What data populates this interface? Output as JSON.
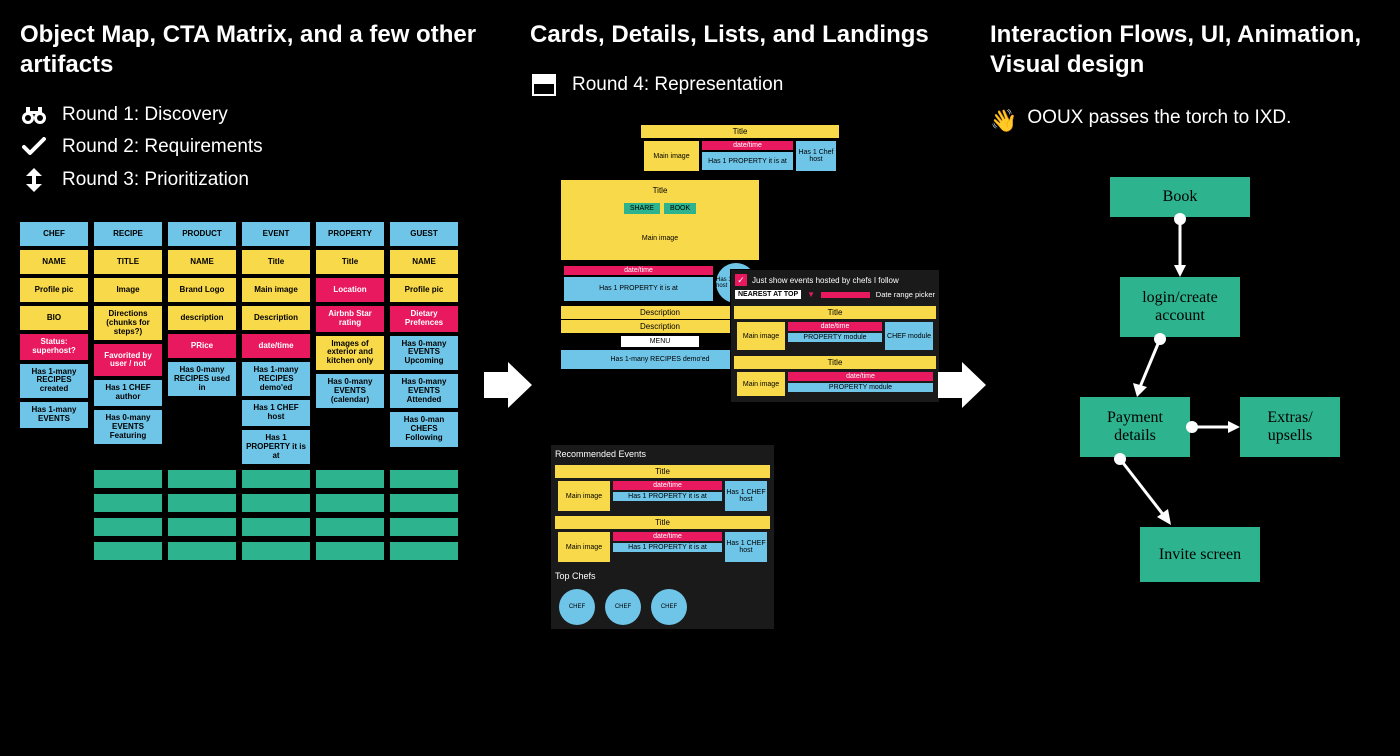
{
  "col1": {
    "heading": "Object Map, CTA Matrix, and a few other artifacts",
    "rounds": [
      {
        "icon": "binoculars",
        "label": "Round 1: Discovery"
      },
      {
        "icon": "check",
        "label": "Round 2: Requirements"
      },
      {
        "icon": "updown",
        "label": "Round 3: Prioritization"
      }
    ],
    "objmap": {
      "columns": [
        {
          "header": "CHEF",
          "cells": [
            {
              "t": "NAME",
              "c": "y"
            },
            {
              "t": "Profile pic",
              "c": "y"
            },
            {
              "t": "BIO",
              "c": "y"
            },
            {
              "t": "Status: superhost?",
              "c": "p"
            },
            {
              "t": "Has 1-many RECIPES created",
              "c": "b"
            },
            {
              "t": "Has 1-many EVENTS",
              "c": "b"
            }
          ]
        },
        {
          "header": "RECIPE",
          "cells": [
            {
              "t": "TITLE",
              "c": "y"
            },
            {
              "t": "Image",
              "c": "y"
            },
            {
              "t": "Directions (chunks for steps?)",
              "c": "y"
            },
            {
              "t": "Favorited by user / not",
              "c": "p"
            },
            {
              "t": "Has 1 CHEF author",
              "c": "b"
            },
            {
              "t": "Has 0-many EVENTS Featuring",
              "c": "b"
            }
          ]
        },
        {
          "header": "PRODUCT",
          "cells": [
            {
              "t": "NAME",
              "c": "y"
            },
            {
              "t": "Brand Logo",
              "c": "y"
            },
            {
              "t": "description",
              "c": "y"
            },
            {
              "t": "PRice",
              "c": "p"
            },
            {
              "t": "Has 0-many RECIPES used in",
              "c": "b"
            }
          ]
        },
        {
          "header": "EVENT",
          "cells": [
            {
              "t": "Title",
              "c": "y"
            },
            {
              "t": "Main image",
              "c": "y"
            },
            {
              "t": "Description",
              "c": "y"
            },
            {
              "t": "date/time",
              "c": "p"
            },
            {
              "t": "Has 1-many RECIPES demo'ed",
              "c": "b"
            },
            {
              "t": "Has 1 CHEF host",
              "c": "b"
            },
            {
              "t": "Has 1 PROPERTY it is at",
              "c": "b"
            }
          ]
        },
        {
          "header": "PROPERTY",
          "cells": [
            {
              "t": "Title",
              "c": "y"
            },
            {
              "t": "Location",
              "c": "p"
            },
            {
              "t": "Airbnb Star rating",
              "c": "p"
            },
            {
              "t": "Images of exterior and kitchen only",
              "c": "y"
            },
            {
              "t": "Has 0-many EVENTS (calendar)",
              "c": "b"
            }
          ]
        },
        {
          "header": "GUEST",
          "cells": [
            {
              "t": "NAME",
              "c": "y"
            },
            {
              "t": "Profile pic",
              "c": "y"
            },
            {
              "t": "Dietary Prefences",
              "c": "p"
            },
            {
              "t": "Has 0-many EVENTS Upcoming",
              "c": "b"
            },
            {
              "t": "Has 0-many EVENTS Attended",
              "c": "b"
            },
            {
              "t": "Has 0-man CHEFS Following",
              "c": "b"
            }
          ]
        }
      ],
      "greenbars_cols": 5,
      "greenbars_rows": 4
    }
  },
  "col2": {
    "heading": "Cards, Details, Lists, and Landings",
    "round": {
      "icon": "card",
      "label": "Round 4: Representation"
    },
    "wf": {
      "title": "Title",
      "main_image": "Main image",
      "date_time": "date/time",
      "has_property": "Has 1 PROPERTY it is at",
      "chef_host": "Has 1 Chef host",
      "chef_host2": "Has 1 CHEF host",
      "share": "SHARE",
      "book": "BOOK",
      "description": "Description",
      "menu": "MENU",
      "recipes": "Has 1-many RECIPES demo'ed",
      "filter_label": "Just show events hosted by chefs I follow",
      "sort_label": "NEAREST AT TOP",
      "date_range": "Date range picker",
      "prop_module": "PROPERTY module",
      "chef_module": "CHEF module",
      "rec_events": "Recommended Events",
      "top_chefs": "Top Chefs",
      "chef": "CHEF"
    }
  },
  "col3": {
    "heading": "Interaction Flows, UI, Animation, Visual design",
    "handoff_icon": "👋",
    "handoff_text": "OOUX  passes the torch to IXD.",
    "flow": {
      "nodes": {
        "book": "Book",
        "login": "login/create account",
        "payment": "Payment details",
        "extras": "Extras/ upsells",
        "invite": "Invite screen"
      }
    }
  }
}
